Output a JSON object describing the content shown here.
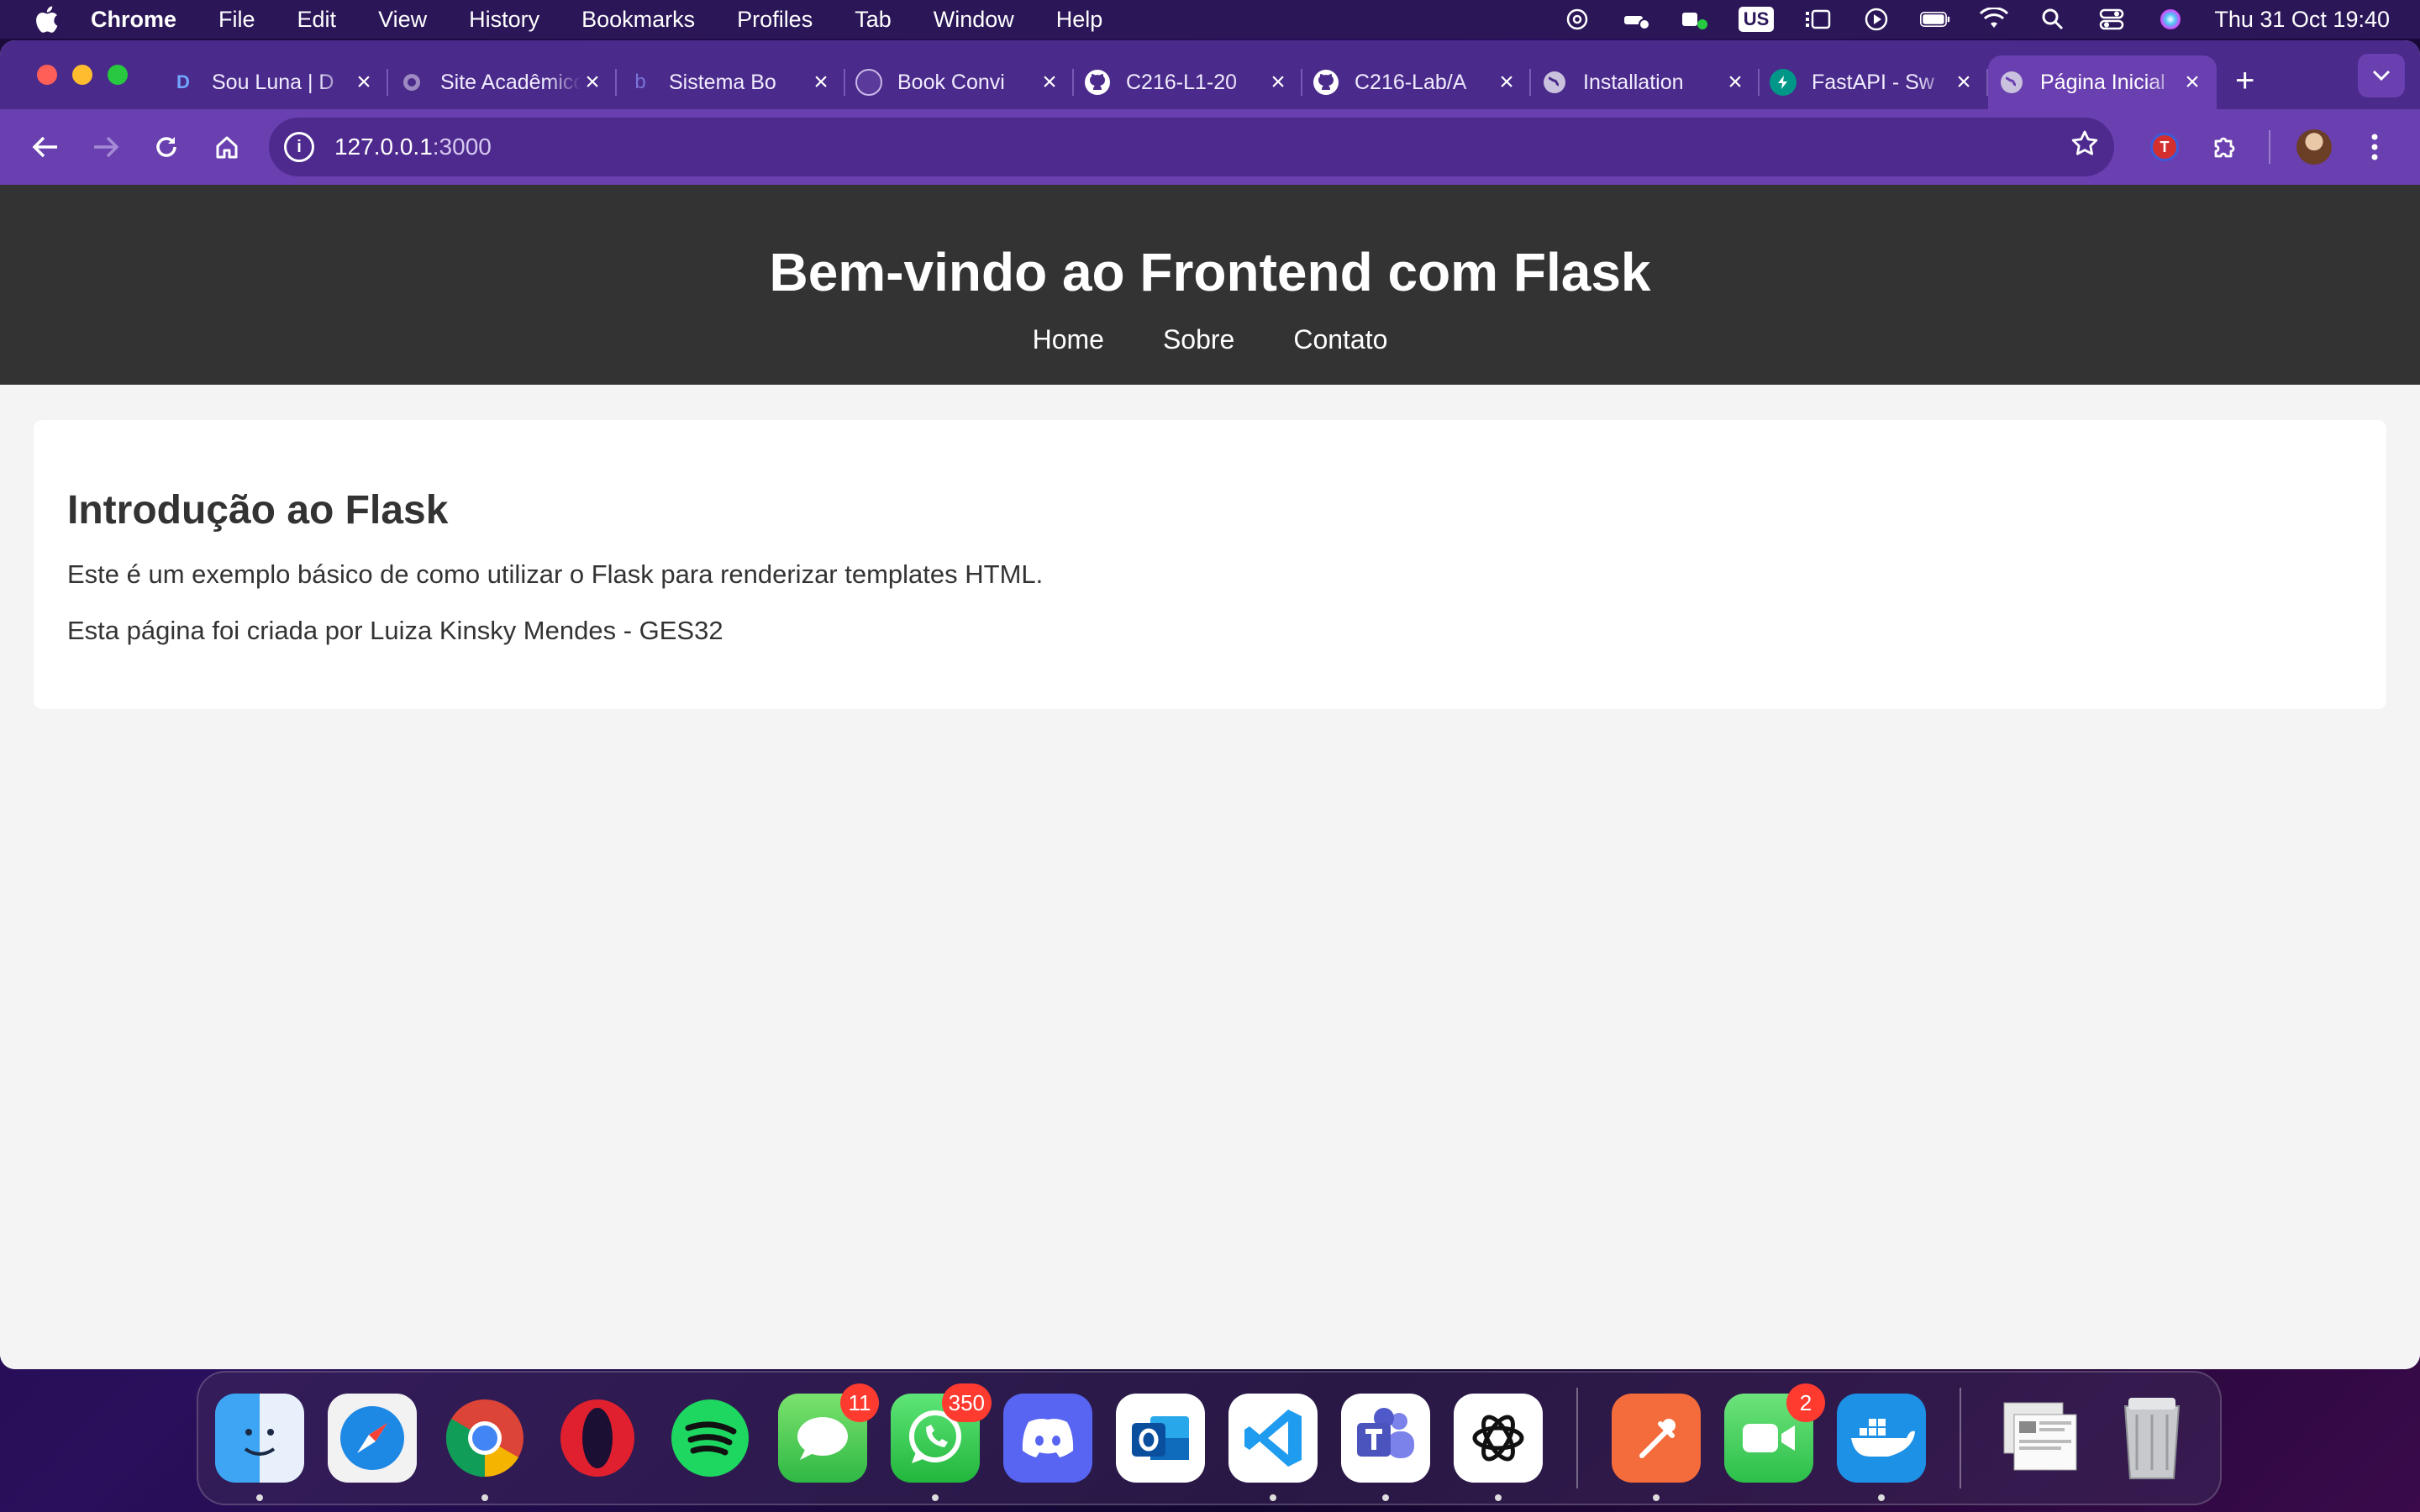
{
  "menubar": {
    "app_name": "Chrome",
    "menus": [
      "File",
      "Edit",
      "View",
      "History",
      "Bookmarks",
      "Profiles",
      "Tab",
      "Window",
      "Help"
    ],
    "input_source": "US",
    "clock": "Thu 31 Oct  19:40"
  },
  "tabs": [
    {
      "title": "Sou Luna | D",
      "icon": "disney-icon",
      "active": false
    },
    {
      "title": "Site Acadêmico",
      "icon": "globe-icon",
      "active": false
    },
    {
      "title": "Sistema Bo",
      "icon": "b-icon",
      "active": false
    },
    {
      "title": "Book Convi",
      "icon": "book-icon",
      "active": false
    },
    {
      "title": "C216-L1-20",
      "icon": "github-icon",
      "active": false
    },
    {
      "title": "C216-Lab/A",
      "icon": "github-icon",
      "active": false
    },
    {
      "title": "Installation",
      "icon": "globe-icon",
      "active": false
    },
    {
      "title": "FastAPI - Sw",
      "icon": "fastapi-icon",
      "active": false
    },
    {
      "title": "Página Inicial",
      "icon": "globe-icon",
      "active": true
    }
  ],
  "toolbar": {
    "url_host": "127.0.0.1",
    "url_port": ":3000"
  },
  "page": {
    "header_title": "Bem-vindo ao Frontend com Flask",
    "nav": [
      "Home",
      "Sobre",
      "Contato"
    ],
    "card_title": "Introdução ao Flask",
    "paragraph_1": "Este é um exemplo básico de como utilizar o Flask para renderizar templates HTML.",
    "paragraph_2": "Esta página foi criada por Luiza Kinsky Mendes - GES32"
  },
  "dock": {
    "items": [
      {
        "name": "finder",
        "badge": "",
        "running": true
      },
      {
        "name": "safari",
        "badge": "",
        "running": false
      },
      {
        "name": "chrome",
        "badge": "",
        "running": true
      },
      {
        "name": "opera",
        "badge": "",
        "running": false
      },
      {
        "name": "spotify",
        "badge": "",
        "running": false
      },
      {
        "name": "messages",
        "badge": "11",
        "running": false
      },
      {
        "name": "whatsapp",
        "badge": "350",
        "running": true
      },
      {
        "name": "discord",
        "badge": "",
        "running": false
      },
      {
        "name": "outlook",
        "badge": "",
        "running": false
      },
      {
        "name": "vscode",
        "badge": "",
        "running": true
      },
      {
        "name": "teams",
        "badge": "",
        "running": true
      },
      {
        "name": "chatgpt",
        "badge": "",
        "running": true
      },
      {
        "name": "postman",
        "badge": "",
        "running": true
      },
      {
        "name": "facetime",
        "badge": "2",
        "running": false
      },
      {
        "name": "docker",
        "badge": "",
        "running": true
      },
      {
        "name": "downloads-stack",
        "badge": "",
        "running": false
      },
      {
        "name": "trash",
        "badge": "",
        "running": false
      }
    ]
  },
  "colors": {
    "menubar_bg": "#2b1658",
    "tabstrip_bg": "#4a2a8a",
    "toolbar_bg": "#6a3fb0",
    "site_header_bg": "#333333",
    "page_bg": "#f4f4f4"
  }
}
